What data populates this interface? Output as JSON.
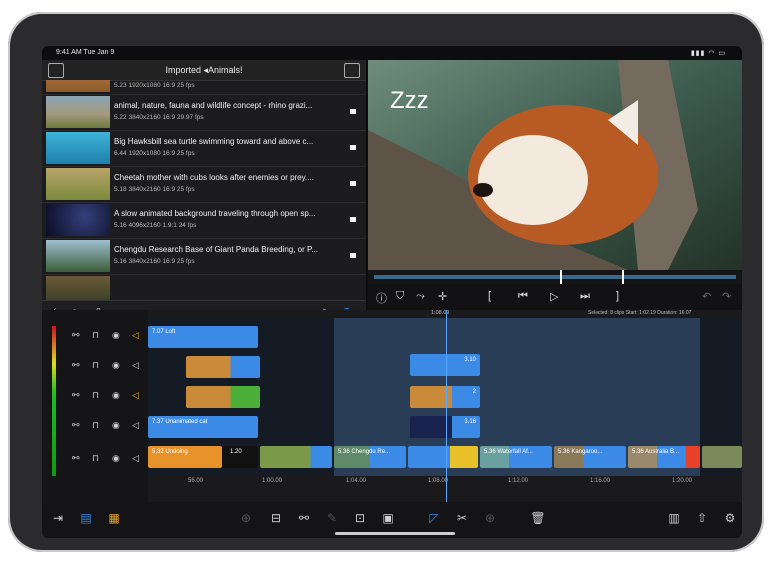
{
  "status": {
    "time": "9:41 AM  Tue Jan 9",
    "indicators": "▮▮▮ ◠ ▭"
  },
  "library": {
    "title": "Imported ◂Animals!",
    "clips": [
      {
        "title": "",
        "meta": "5.23  1920x1080  16:9  25 fps"
      },
      {
        "title": "animal, nature, fauna and wildlife concept - rhino grazi...",
        "meta": "5.22  3840x2160  16:9  29.97 fps"
      },
      {
        "title": "Big Hawksbill sea turtle swimming toward and above c...",
        "meta": "6.44  1920x1080  16:9  25 fps"
      },
      {
        "title": "Cheetah mother with cubs looks after enemies or prey....",
        "meta": "5.18  3840x2160  16:9  25 fps"
      },
      {
        "title": "A slow animated background traveling through open sp...",
        "meta": "5.16  4096x2160  1.9:1  24 fps"
      },
      {
        "title": "Chengdu Research Base of Giant Panda Breeding, or P...",
        "meta": "5.16  3840x2160  16:9  25 fps"
      }
    ]
  },
  "viewer": {
    "overlay_text": "Zzz"
  },
  "timeline": {
    "playhead_time": "1:08.09",
    "selected_info": "Selected: 8 clips  Start: 1:02.19  Duration: 16.07",
    "clips": {
      "loft": "7.07  Loft",
      "unanimated": "7.37  Unanimated cat",
      "undoing": "5.32  Undoing",
      "audio": "1.20",
      "chengdu": "5.36  Chengdu Re...",
      "waterfall": "5.36  Waterfall Af...",
      "kangaroo": "5.36  Kangaroo...",
      "australia": "5.36  Australia B...",
      "c310a": "3.10",
      "c2": "2",
      "c310b": "3.16"
    },
    "ruler_labels": [
      "56.00",
      "1:00.00",
      "1:04.00",
      "1:08.00",
      "1:12.00",
      "1:16.00",
      "1:20.00"
    ]
  },
  "colors": {
    "accent": "#3a8ae6",
    "orange": "#e89a2a",
    "green": "#4caf3a"
  }
}
